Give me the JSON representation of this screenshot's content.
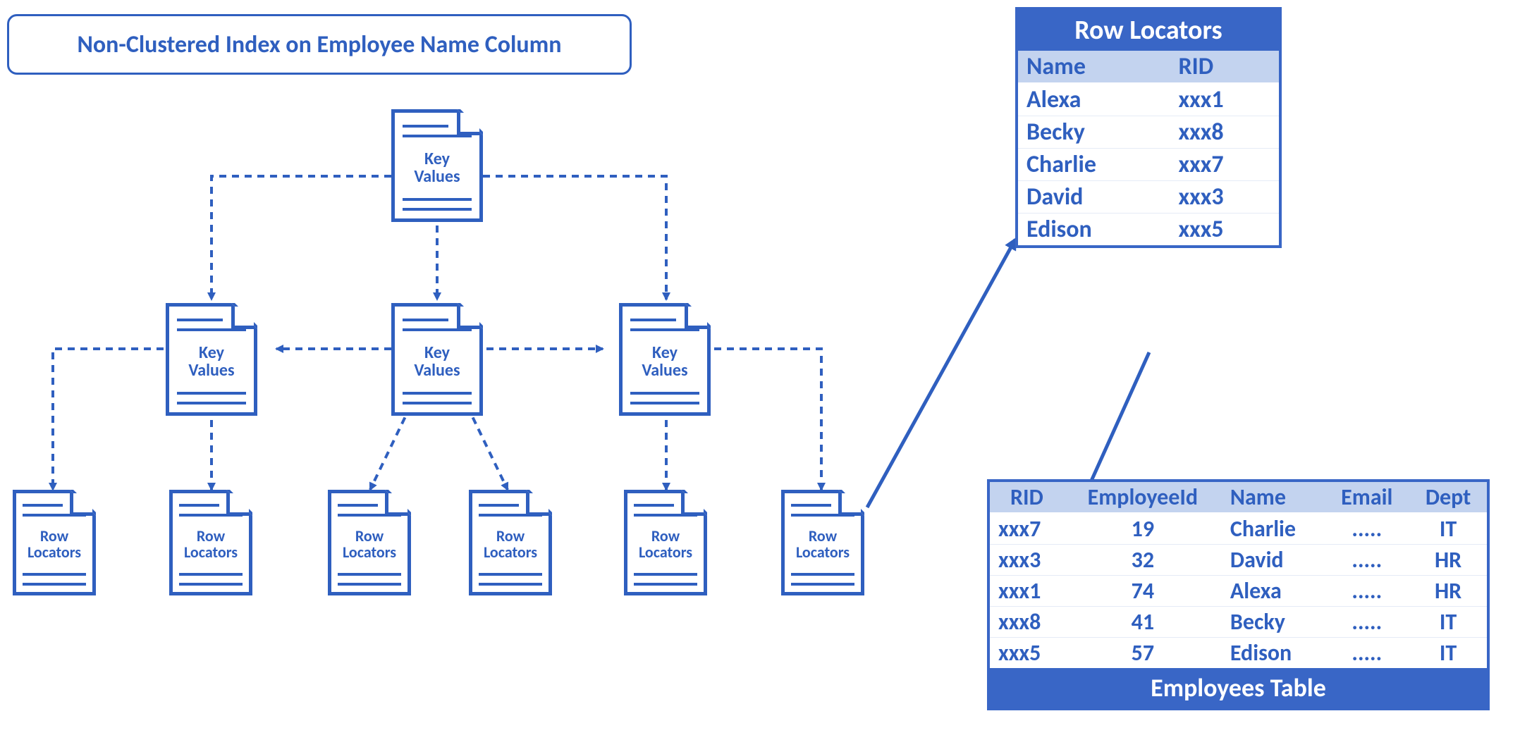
{
  "title": "Non-Clustered Index on Employee Name Column",
  "node_labels": {
    "key_values": "Key\nValues",
    "row_locators": "Row\nLocators"
  },
  "row_locators_table": {
    "title": "Row Locators",
    "columns": [
      "Name",
      "RID"
    ],
    "rows": [
      {
        "name": "Alexa",
        "rid": "xxx1"
      },
      {
        "name": "Becky",
        "rid": "xxx8"
      },
      {
        "name": "Charlie",
        "rid": "xxx7"
      },
      {
        "name": "David",
        "rid": "xxx3"
      },
      {
        "name": "Edison",
        "rid": "xxx5"
      }
    ]
  },
  "employees_table": {
    "title": "Employees Table",
    "columns": [
      "RID",
      "EmployeeId",
      "Name",
      "Email",
      "Dept"
    ],
    "rows": [
      {
        "rid": "xxx7",
        "employee_id": "19",
        "name": "Charlie",
        "email": ".....",
        "dept": "IT"
      },
      {
        "rid": "xxx3",
        "employee_id": "32",
        "name": "David",
        "email": ".....",
        "dept": "HR"
      },
      {
        "rid": "xxx1",
        "employee_id": "74",
        "name": "Alexa",
        "email": ".....",
        "dept": "HR"
      },
      {
        "rid": "xxx8",
        "employee_id": "41",
        "name": "Becky",
        "email": ".....",
        "dept": "IT"
      },
      {
        "rid": "xxx5",
        "employee_id": "57",
        "name": "Edison",
        "email": ".....",
        "dept": "IT"
      }
    ]
  }
}
